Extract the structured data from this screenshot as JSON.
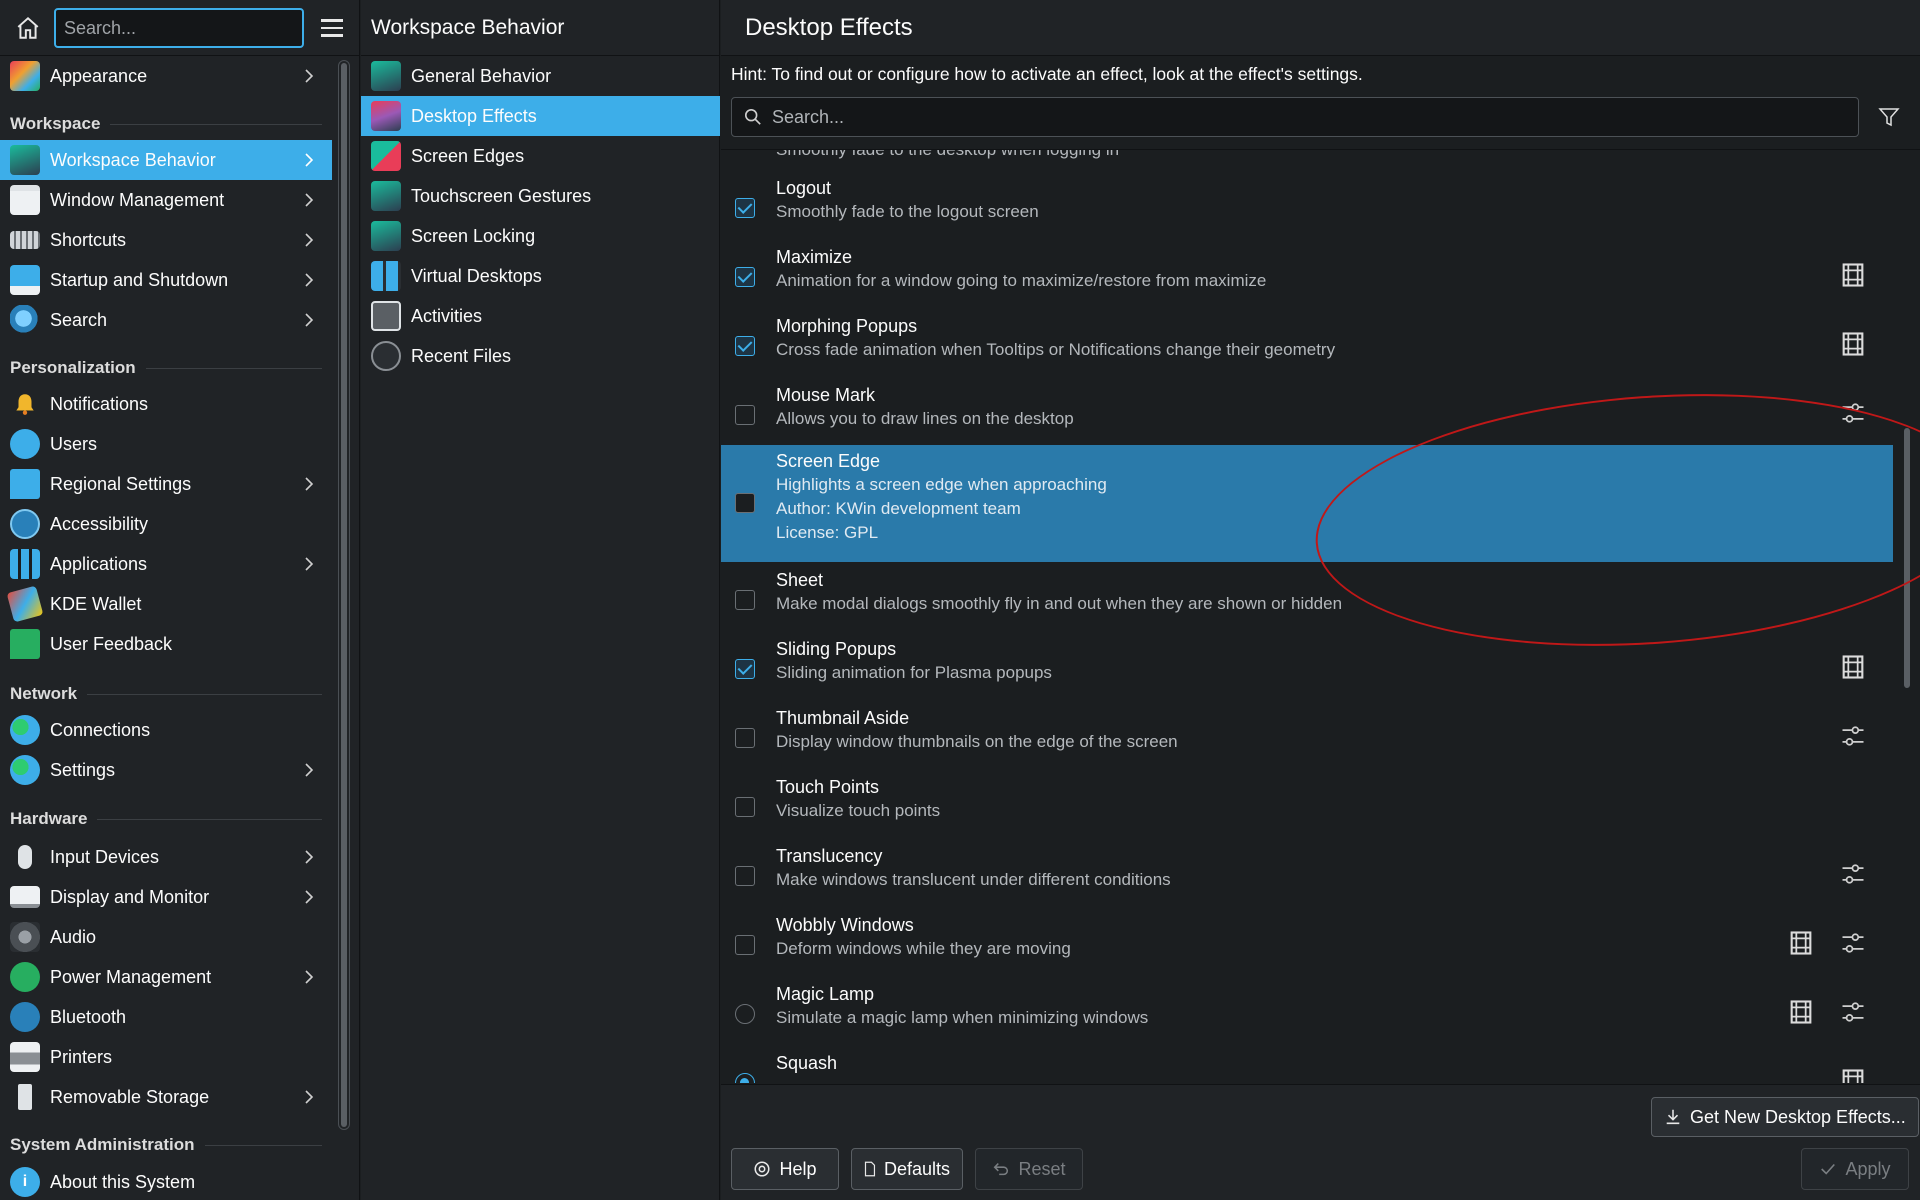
{
  "sidebar": {
    "search_placeholder": "Search...",
    "items": [
      {
        "label": "Appearance",
        "icon": "appearance-icon",
        "chevron": true
      },
      {
        "label": "Workspace Behavior",
        "icon": "workspace-behavior-icon",
        "chevron": true,
        "selected": true
      },
      {
        "label": "Window Management",
        "icon": "window-management-icon",
        "chevron": true
      },
      {
        "label": "Shortcuts",
        "icon": "keyboard-icon",
        "chevron": true
      },
      {
        "label": "Startup and Shutdown",
        "icon": "startup-icon",
        "chevron": true
      },
      {
        "label": "Search",
        "icon": "search-icon",
        "chevron": true
      },
      {
        "label": "Notifications",
        "icon": "bell-icon",
        "chevron": false
      },
      {
        "label": "Users",
        "icon": "users-icon",
        "chevron": false
      },
      {
        "label": "Regional Settings",
        "icon": "regional-icon",
        "chevron": true
      },
      {
        "label": "Accessibility",
        "icon": "accessibility-icon",
        "chevron": false
      },
      {
        "label": "Applications",
        "icon": "applications-icon",
        "chevron": true
      },
      {
        "label": "KDE Wallet",
        "icon": "wallet-icon",
        "chevron": false
      },
      {
        "label": "User Feedback",
        "icon": "feedback-icon",
        "chevron": false
      },
      {
        "label": "Connections",
        "icon": "globe-icon",
        "chevron": false
      },
      {
        "label": "Settings",
        "icon": "globe-icon",
        "chevron": true
      },
      {
        "label": "Input Devices",
        "icon": "mouse-icon",
        "chevron": true
      },
      {
        "label": "Display and Monitor",
        "icon": "monitor-icon",
        "chevron": true
      },
      {
        "label": "Audio",
        "icon": "speaker-icon",
        "chevron": false
      },
      {
        "label": "Power Management",
        "icon": "power-icon",
        "chevron": true
      },
      {
        "label": "Bluetooth",
        "icon": "bluetooth-icon",
        "chevron": false
      },
      {
        "label": "Printers",
        "icon": "printer-icon",
        "chevron": false
      },
      {
        "label": "Removable Storage",
        "icon": "usb-icon",
        "chevron": true
      },
      {
        "label": "About this System",
        "icon": "info-icon",
        "chevron": false
      }
    ],
    "sections": {
      "workspace": "Workspace",
      "personalization": "Personalization",
      "network": "Network",
      "hardware": "Hardware",
      "system_administration": "System Administration"
    }
  },
  "middle": {
    "title": "Workspace Behavior",
    "items": [
      {
        "label": "General Behavior",
        "icon": "general-behavior-icon"
      },
      {
        "label": "Desktop Effects",
        "icon": "desktop-effects-icon",
        "selected": true
      },
      {
        "label": "Screen Edges",
        "icon": "screen-edges-icon"
      },
      {
        "label": "Touchscreen Gestures",
        "icon": "touch-gestures-icon"
      },
      {
        "label": "Screen Locking",
        "icon": "lock-icon"
      },
      {
        "label": "Virtual Desktops",
        "icon": "virtual-desktops-icon"
      },
      {
        "label": "Activities",
        "icon": "activities-icon"
      },
      {
        "label": "Recent Files",
        "icon": "clock-icon"
      }
    ]
  },
  "main": {
    "title": "Desktop Effects",
    "hint": "Hint: To find out or configure how to activate an effect, look at the effect's settings.",
    "search_placeholder": "Search...",
    "partial_top_desc": "Smoothly fade to the desktop when logging in",
    "effects": [
      {
        "name": "Logout",
        "desc": "Smoothly fade to the logout screen",
        "control": "checkbox",
        "checked": true,
        "video": false,
        "configure": false
      },
      {
        "name": "Maximize",
        "desc": "Animation for a window going to maximize/restore from maximize",
        "control": "checkbox",
        "checked": true,
        "video": true,
        "configure": false
      },
      {
        "name": "Morphing Popups",
        "desc": "Cross fade animation when Tooltips or Notifications change their geometry",
        "control": "checkbox",
        "checked": true,
        "video": true,
        "configure": false
      },
      {
        "name": "Mouse Mark",
        "desc": "Allows you to draw lines on the desktop",
        "control": "checkbox",
        "checked": false,
        "video": false,
        "configure": true
      },
      {
        "name": "Screen Edge",
        "desc": "Highlights a screen edge when approaching",
        "author": "Author: KWin development team",
        "license": "License: GPL",
        "control": "checkbox",
        "checked": false,
        "selected": true
      },
      {
        "name": "Sheet",
        "desc": "Make modal dialogs smoothly fly in and out when they are shown or hidden",
        "control": "checkbox",
        "checked": false,
        "video": false,
        "configure": false
      },
      {
        "name": "Sliding Popups",
        "desc": "Sliding animation for Plasma popups",
        "control": "checkbox",
        "checked": true,
        "video": true,
        "configure": false
      },
      {
        "name": "Thumbnail Aside",
        "desc": "Display window thumbnails on the edge of the screen",
        "control": "checkbox",
        "checked": false,
        "video": false,
        "configure": true
      },
      {
        "name": "Touch Points",
        "desc": "Visualize touch points",
        "control": "checkbox",
        "checked": false,
        "video": false,
        "configure": false
      },
      {
        "name": "Translucency",
        "desc": "Make windows translucent under different conditions",
        "control": "checkbox",
        "checked": false,
        "video": false,
        "configure": true
      },
      {
        "name": "Wobbly Windows",
        "desc": "Deform windows while they are moving",
        "control": "checkbox",
        "checked": false,
        "video": true,
        "configure": true
      },
      {
        "name": "Magic Lamp",
        "desc": "Simulate a magic lamp when minimizing windows",
        "control": "radio",
        "checked": false,
        "video": true,
        "configure": true
      },
      {
        "name": "Squash",
        "desc": "",
        "control": "radio",
        "checked": true,
        "video": true,
        "configure": false
      }
    ],
    "buttons": {
      "get_new": "Get New Desktop Effects...",
      "help": "Help",
      "defaults": "Defaults",
      "reset": "Reset",
      "apply": "Apply"
    }
  },
  "colors": {
    "accent": "#3daee9",
    "selected_row": "#2a7aaa",
    "annotation": "#c01818"
  }
}
